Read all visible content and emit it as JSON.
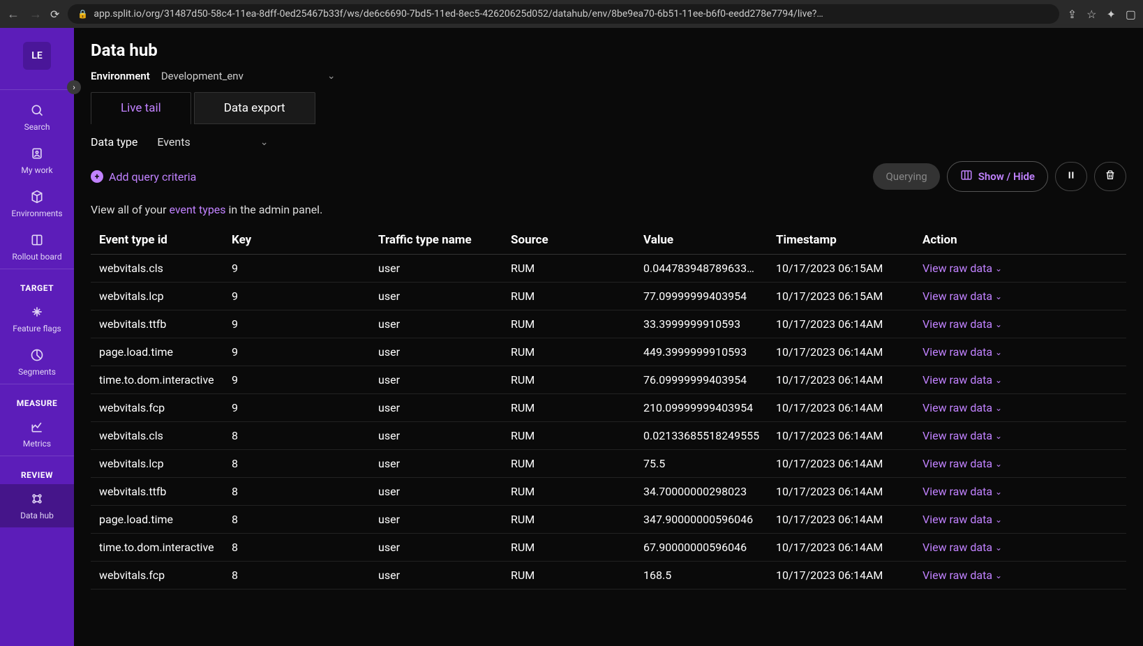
{
  "browser": {
    "url": "app.split.io/org/31487d50-58c4-11ea-8dff-0ed25467b33f/ws/de6c6690-7bd5-11ed-8ec5-42620625d052/datahub/env/8be9ea70-6b51-11ee-b6f0-eedd278e7794/live?…"
  },
  "org_badge": "LE",
  "sidebar": {
    "items": [
      {
        "label": "Search"
      },
      {
        "label": "My work"
      },
      {
        "label": "Environments"
      },
      {
        "label": "Rollout board"
      }
    ],
    "section_target": "TARGET",
    "target_items": [
      {
        "label": "Feature flags"
      },
      {
        "label": "Segments"
      }
    ],
    "section_measure": "MEASURE",
    "measure_items": [
      {
        "label": "Metrics"
      }
    ],
    "section_review": "REVIEW",
    "review_items": [
      {
        "label": "Data hub"
      }
    ]
  },
  "page": {
    "title": "Data hub",
    "env_label": "Environment",
    "env_value": "Development_env"
  },
  "tabs": {
    "live_tail": "Live tail",
    "data_export": "Data export"
  },
  "datatype": {
    "label": "Data type",
    "value": "Events"
  },
  "toolbar": {
    "add_criteria": "Add query criteria",
    "querying": "Querying",
    "show_hide": "Show / Hide"
  },
  "helper": {
    "prefix": "View all of your ",
    "link": "event types",
    "suffix": " in the admin panel."
  },
  "table": {
    "headers": {
      "event_type": "Event type id",
      "key": "Key",
      "traffic": "Traffic type name",
      "source": "Source",
      "value": "Value",
      "timestamp": "Timestamp",
      "action": "Action"
    },
    "action_label": "View raw data",
    "rows": [
      {
        "event": "webvitals.cls",
        "key": "9",
        "traffic": "user",
        "source": "RUM",
        "value": "0.044783948789633…",
        "ts": "10/17/2023 06:15AM"
      },
      {
        "event": "webvitals.lcp",
        "key": "9",
        "traffic": "user",
        "source": "RUM",
        "value": "77.09999999403954",
        "ts": "10/17/2023 06:15AM"
      },
      {
        "event": "webvitals.ttfb",
        "key": "9",
        "traffic": "user",
        "source": "RUM",
        "value": "33.3999999910593",
        "ts": "10/17/2023 06:14AM"
      },
      {
        "event": "page.load.time",
        "key": "9",
        "traffic": "user",
        "source": "RUM",
        "value": "449.3999999910593",
        "ts": "10/17/2023 06:14AM"
      },
      {
        "event": "time.to.dom.interactive",
        "key": "9",
        "traffic": "user",
        "source": "RUM",
        "value": "76.09999999403954",
        "ts": "10/17/2023 06:14AM"
      },
      {
        "event": "webvitals.fcp",
        "key": "9",
        "traffic": "user",
        "source": "RUM",
        "value": "210.09999999403954",
        "ts": "10/17/2023 06:14AM"
      },
      {
        "event": "webvitals.cls",
        "key": "8",
        "traffic": "user",
        "source": "RUM",
        "value": "0.02133685518249555",
        "ts": "10/17/2023 06:14AM"
      },
      {
        "event": "webvitals.lcp",
        "key": "8",
        "traffic": "user",
        "source": "RUM",
        "value": "75.5",
        "ts": "10/17/2023 06:14AM"
      },
      {
        "event": "webvitals.ttfb",
        "key": "8",
        "traffic": "user",
        "source": "RUM",
        "value": "34.70000000298023",
        "ts": "10/17/2023 06:14AM"
      },
      {
        "event": "page.load.time",
        "key": "8",
        "traffic": "user",
        "source": "RUM",
        "value": "347.90000000596046",
        "ts": "10/17/2023 06:14AM"
      },
      {
        "event": "time.to.dom.interactive",
        "key": "8",
        "traffic": "user",
        "source": "RUM",
        "value": "67.90000000596046",
        "ts": "10/17/2023 06:14AM"
      },
      {
        "event": "webvitals.fcp",
        "key": "8",
        "traffic": "user",
        "source": "RUM",
        "value": "168.5",
        "ts": "10/17/2023 06:14AM"
      }
    ]
  }
}
